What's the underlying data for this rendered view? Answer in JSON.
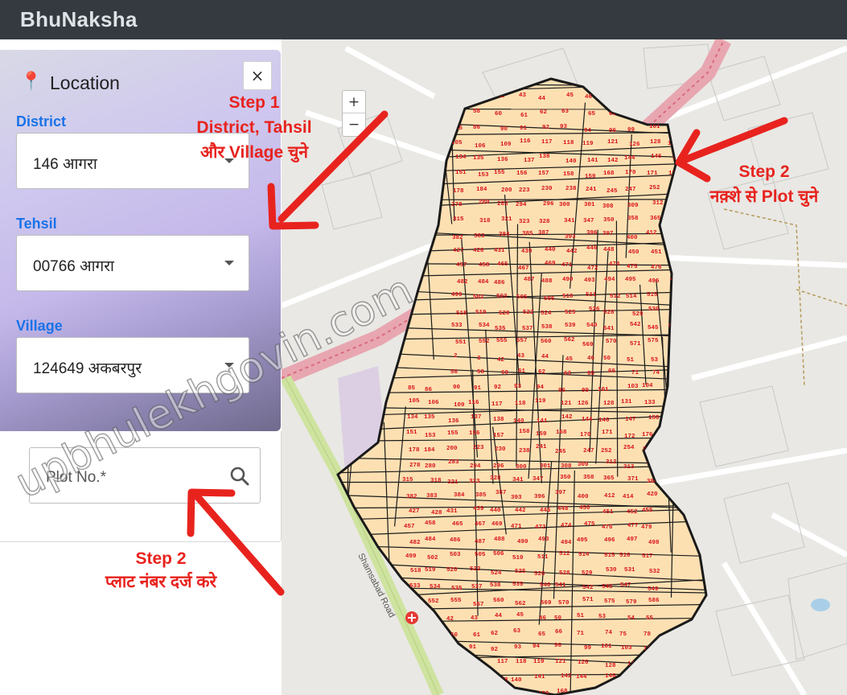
{
  "app": {
    "brand": "BhuNaksha"
  },
  "sidebar": {
    "title": "Location",
    "close": "×",
    "district": {
      "label": "District",
      "value": "146 आगरा"
    },
    "tehsil": {
      "label": "Tehsil",
      "value": "00766 आगरा"
    },
    "village": {
      "label": "Village",
      "value": "124649 अकबरपुर"
    },
    "plot": {
      "placeholder": "Plot No.*"
    }
  },
  "map": {
    "zoom_in": "+",
    "zoom_out": "−",
    "road_label": "Shamsabad Road",
    "plot_numbers": [
      "2",
      "3",
      "42",
      "43",
      "44",
      "45",
      "46",
      "50",
      "51",
      "53",
      "54",
      "55",
      "56",
      "58",
      "60",
      "61",
      "62",
      "63",
      "65",
      "66",
      "71",
      "74",
      "75",
      "78",
      "85",
      "86",
      "90",
      "91",
      "92",
      "93",
      "94",
      "96",
      "99",
      "101",
      "103",
      "104",
      "105",
      "106",
      "109",
      "116",
      "117",
      "118",
      "119",
      "121",
      "126",
      "128",
      "131",
      "133",
      "134",
      "135",
      "136",
      "137",
      "138",
      "140",
      "141",
      "142",
      "144",
      "146",
      "147",
      "150",
      "151",
      "153",
      "155",
      "156",
      "157",
      "158",
      "159",
      "168",
      "170",
      "171",
      "172",
      "176",
      "178",
      "184",
      "200",
      "223",
      "230",
      "238",
      "241",
      "245",
      "247",
      "252",
      "254",
      "273",
      "278",
      "280",
      "283",
      "294",
      "296",
      "300",
      "301",
      "308",
      "309",
      "312",
      "313",
      "314",
      "315",
      "318",
      "321",
      "323",
      "328",
      "341",
      "347",
      "350",
      "358",
      "365",
      "371",
      "380",
      "382",
      "383",
      "384",
      "385",
      "387",
      "393",
      "396",
      "397",
      "400",
      "412",
      "414",
      "420",
      "427",
      "428",
      "431",
      "439",
      "440",
      "442",
      "446",
      "448",
      "450",
      "451",
      "452",
      "455",
      "457",
      "458",
      "465",
      "467",
      "469",
      "471",
      "472",
      "474",
      "475",
      "476",
      "477",
      "479",
      "482",
      "484",
      "486",
      "487",
      "488",
      "490",
      "493",
      "494",
      "495",
      "496",
      "497",
      "498",
      "499",
      "502",
      "503",
      "505",
      "506",
      "510",
      "511",
      "512",
      "514",
      "515",
      "516",
      "517",
      "518",
      "519",
      "520",
      "522",
      "524",
      "525",
      "526",
      "528",
      "529",
      "530",
      "531",
      "532",
      "533",
      "534",
      "535",
      "537",
      "538",
      "539",
      "540",
      "541",
      "542",
      "545",
      "547",
      "549",
      "551",
      "552",
      "555",
      "557",
      "560",
      "562",
      "569",
      "570",
      "571",
      "575",
      "579",
      "586"
    ]
  },
  "annotations": {
    "step1_title": "Step 1",
    "step1_line1": "District, Tahsil",
    "step1_line2": "और Village चुने",
    "step2_map_title": "Step 2",
    "step2_map_text": "नक़्शे से Plot चुने",
    "step2_plot_title": "Step 2",
    "step2_plot_text": "प्लाट नंबर दर्ज करे"
  },
  "watermark": "upbhulekhgovin.com",
  "colors": {
    "annotation": "#e8231e",
    "label_blue": "#1a73e8",
    "parcel_fill": "#fde0b2",
    "topbar": "#343a40"
  }
}
